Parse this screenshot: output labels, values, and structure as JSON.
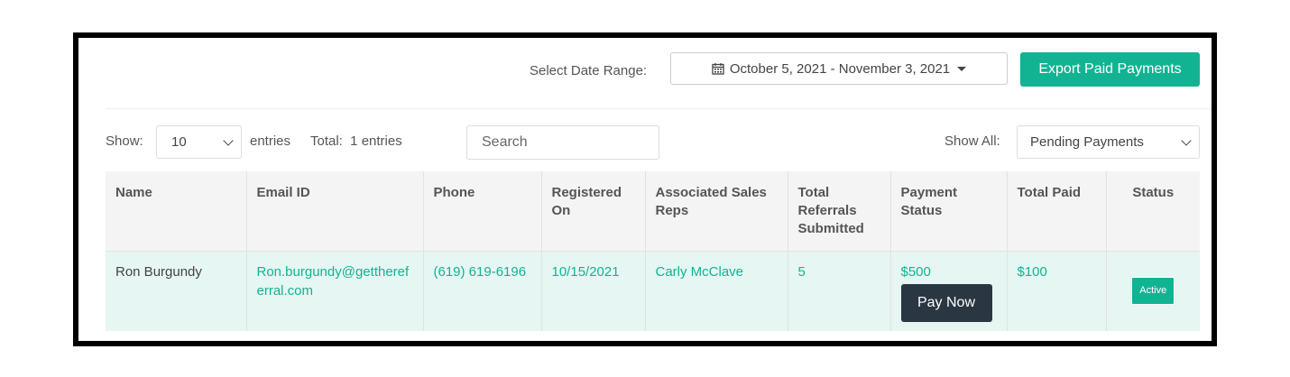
{
  "header": {
    "date_range_label": "Select Date Range:",
    "date_range_value": "October 5, 2021 - November 3, 2021",
    "export_button": "Export Paid Payments"
  },
  "controls": {
    "show_label": "Show:",
    "show_value": "10",
    "entries_label": "entries",
    "total_label": "Total:  1 entries",
    "search_placeholder": "Search",
    "show_all_label": "Show All:",
    "show_all_value": "Pending Payments"
  },
  "table": {
    "columns": [
      "Name",
      "Email ID",
      "Phone",
      "Registered On",
      "Associated Sales Reps",
      "Total Referrals Submitted",
      "Payment Status",
      "Total Paid",
      "Status"
    ],
    "rows": [
      {
        "name": "Ron Burgundy",
        "email": "Ron.burgundy@getthereferral.com",
        "phone": "(619) 619-6196",
        "registered_on": "10/15/2021",
        "sales_rep": "Carly McClave",
        "total_referrals": "5",
        "payment_status": "$500",
        "pay_button": "Pay Now",
        "total_paid": "$100",
        "status": "Active"
      }
    ]
  },
  "colors": {
    "accent": "#12b393",
    "row_highlight": "#e6f6f2",
    "dark_button": "#2a3642"
  },
  "icons": [
    "calendar-icon",
    "caret-down-icon",
    "chevron-down-icon"
  ]
}
